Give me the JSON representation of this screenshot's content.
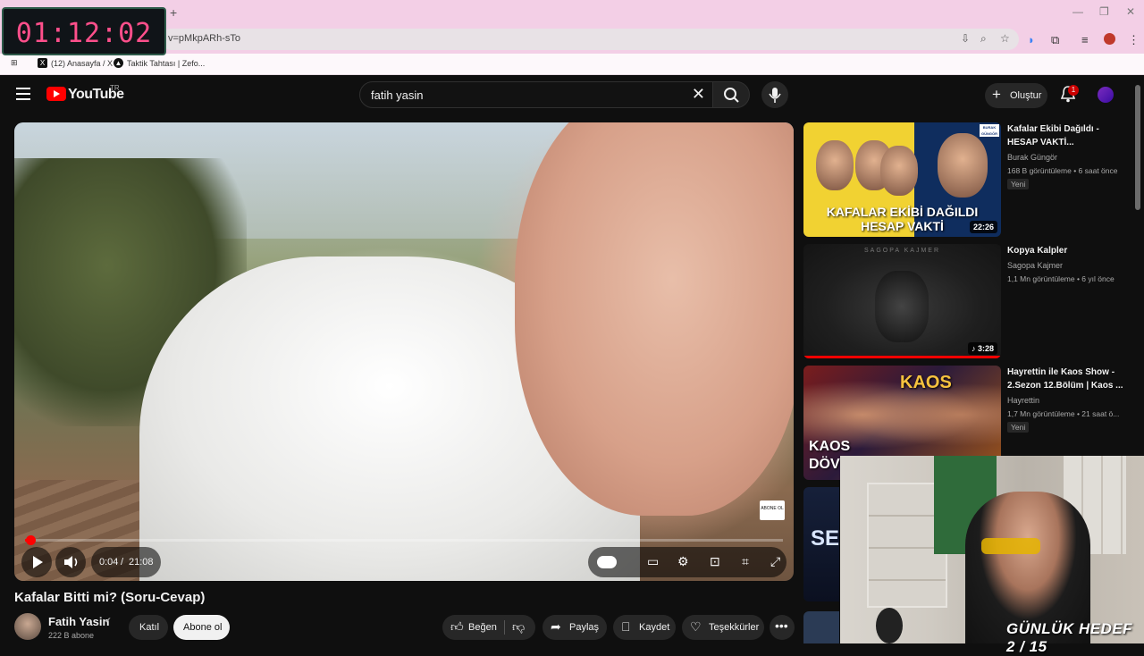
{
  "browser": {
    "url": "v=pMkpARh-sTo",
    "bookmarks": [
      {
        "label": "(12) Anasayfa / X",
        "icon": "x-logo-icon"
      },
      {
        "label": "Taktik Tahtası | Zefo...",
        "icon": "zefo-logo-icon"
      }
    ]
  },
  "overlay": {
    "timer": "01:12:02",
    "goal": "GÜNLÜK HEDEF 2 / 15"
  },
  "youtube": {
    "logo": "YouTube",
    "region": "TR",
    "search_value": "fatih yasin",
    "create_label": "Oluştur",
    "notification_count": "1"
  },
  "player": {
    "current_time": "0:04",
    "separator": "/",
    "duration": "21:08",
    "progress_fraction": 0.003,
    "watermark": "ABONE OL",
    "accent": "#ff0000"
  },
  "video": {
    "title": "Kafalar Bitti mi? (Soru-Cevap)",
    "channel": "Fatih Yasin",
    "subscribers": "222 B abone",
    "join_label": "Katıl",
    "subscribe_label": "Abone ol",
    "like_label": "Beğen",
    "share_label": "Paylaş",
    "save_label": "Kaydet",
    "thanks_label": "Teşekkürler"
  },
  "sidebar": [
    {
      "title": "Kafalar Ekibi Dağıldı - HESAP VAKTİ...",
      "channel": "Burak Güngör",
      "meta": "168 B görüntüleme • 6 saat önce",
      "badge": "Yeni",
      "duration": "22:26",
      "thumb_line1": "KAFALAR EKİBİ DAĞILDI",
      "thumb_line2": "HESAP VAKTİ",
      "thumb_tag": "BURAK GÜNGÖR"
    },
    {
      "title": "Kopya Kalpler",
      "channel": "Sagopa Kajmer",
      "meta": "1,1 Mn görüntüleme • 6 yıl önce",
      "duration": "3:28",
      "thumb_line1": "SAGOPA KAJMER"
    },
    {
      "title": "Hayrettin ile Kaos Show - 2.Sezon 12.Bölüm | Kaos ...",
      "channel": "Hayrettin",
      "meta": "1,7 Mn görüntüleme • 21 saat ö...",
      "badge": "Yeni",
      "thumb_line1": "KAOS",
      "thumb_line2": "KAOS",
      "thumb_line3": "DÖV"
    }
  ],
  "partial_thumb_text": "SE"
}
